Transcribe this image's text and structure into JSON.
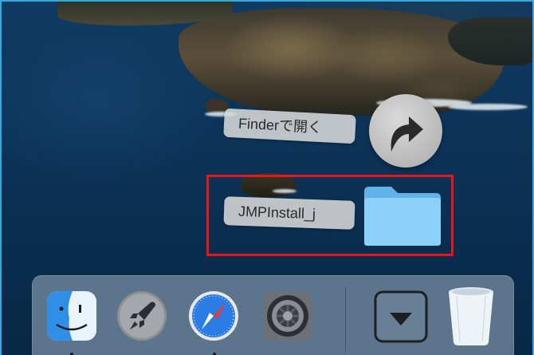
{
  "context_menu": {
    "open_in_finder_label": "Finderで開く",
    "folder_label": "JMPInstall_j"
  },
  "colors": {
    "highlight": "#e8151b",
    "folder": "#7cc7f5"
  },
  "dock": {
    "apps": [
      {
        "name": "Finder",
        "icon": "finder-icon"
      },
      {
        "name": "Launchpad",
        "icon": "launchpad-icon"
      },
      {
        "name": "Safari",
        "icon": "safari-icon"
      },
      {
        "name": "System Preferences",
        "icon": "gear-icon"
      }
    ],
    "stack": {
      "icon": "downloads-stack-icon"
    },
    "trash": {
      "icon": "trash-icon"
    }
  }
}
